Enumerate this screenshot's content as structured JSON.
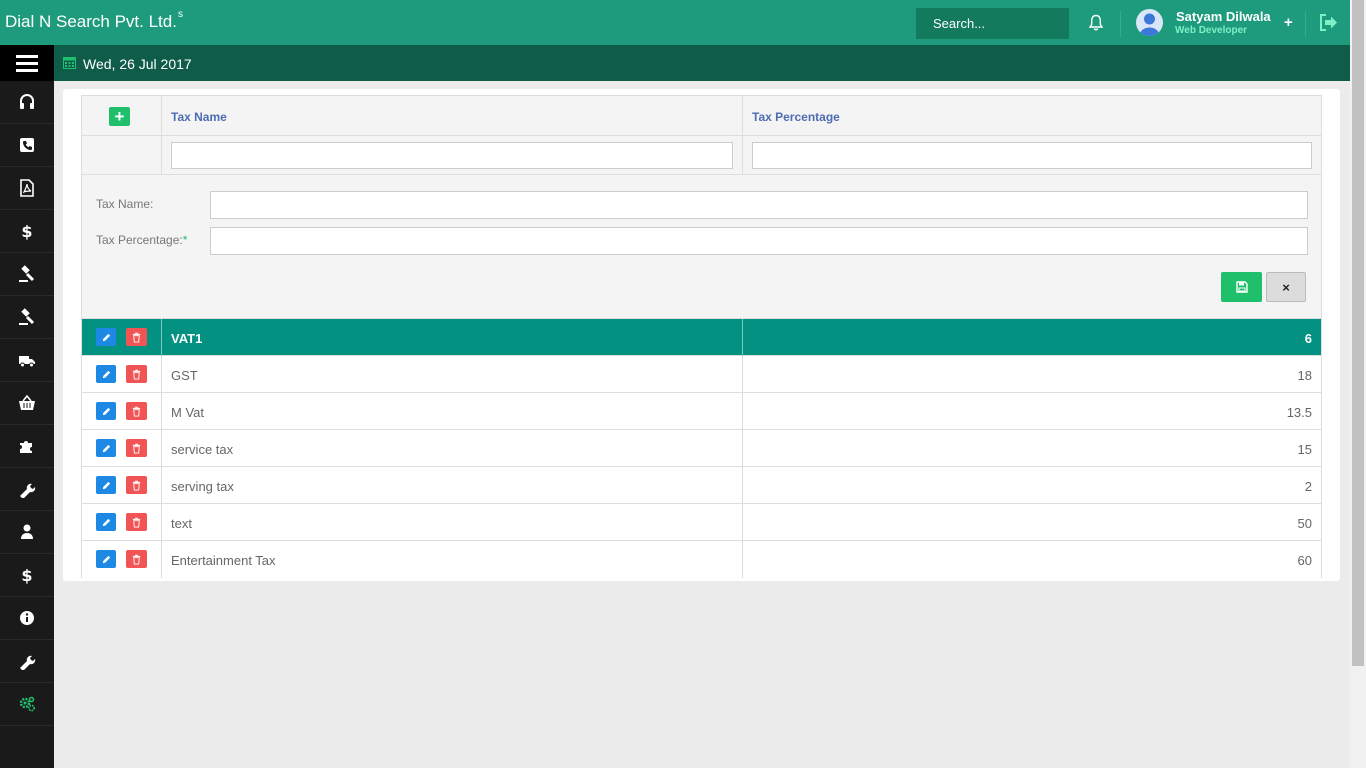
{
  "header": {
    "brand": "Dial N Search Pvt. Ltd.",
    "brand_sup": "s",
    "search_placeholder": "Search...",
    "user_name": "Satyam Dilwala",
    "user_role": "Web Developer",
    "plus": "+"
  },
  "subbar": {
    "date": "Wed, 26 Jul 2017"
  },
  "sidebar": {
    "items": [
      {
        "icon": "headset-icon"
      },
      {
        "icon": "phone-icon"
      },
      {
        "icon": "pdf-icon"
      },
      {
        "icon": "dollar-icon"
      },
      {
        "icon": "gavel-icon"
      },
      {
        "icon": "gavel-icon"
      },
      {
        "icon": "truck-icon"
      },
      {
        "icon": "basket-icon"
      },
      {
        "icon": "puzzle-icon"
      },
      {
        "icon": "wrench-icon"
      },
      {
        "icon": "user-icon"
      },
      {
        "icon": "dollar-icon"
      },
      {
        "icon": "info-icon"
      },
      {
        "icon": "wrench-icon"
      },
      {
        "icon": "cogs-icon"
      }
    ]
  },
  "grid": {
    "columns": [
      "Tax Name",
      "Tax Percentage"
    ],
    "add_label": "+"
  },
  "form": {
    "tax_name_label": "Tax Name:",
    "tax_pct_label": "Tax Percentage:",
    "required_mark": "*",
    "cancel_label": "×"
  },
  "rows": [
    {
      "name": "VAT1",
      "pct": "6"
    },
    {
      "name": "GST",
      "pct": "18"
    },
    {
      "name": "M Vat",
      "pct": "13.5"
    },
    {
      "name": "service tax",
      "pct": "15"
    },
    {
      "name": "serving tax",
      "pct": "2"
    },
    {
      "name": "text",
      "pct": "50"
    },
    {
      "name": "Entertainment Tax",
      "pct": "60"
    }
  ],
  "colors": {
    "primary": "#1d9b7c",
    "dark": "#0f5c4a",
    "selected_row": "#039182",
    "sidebar": "#1a1a1a"
  }
}
